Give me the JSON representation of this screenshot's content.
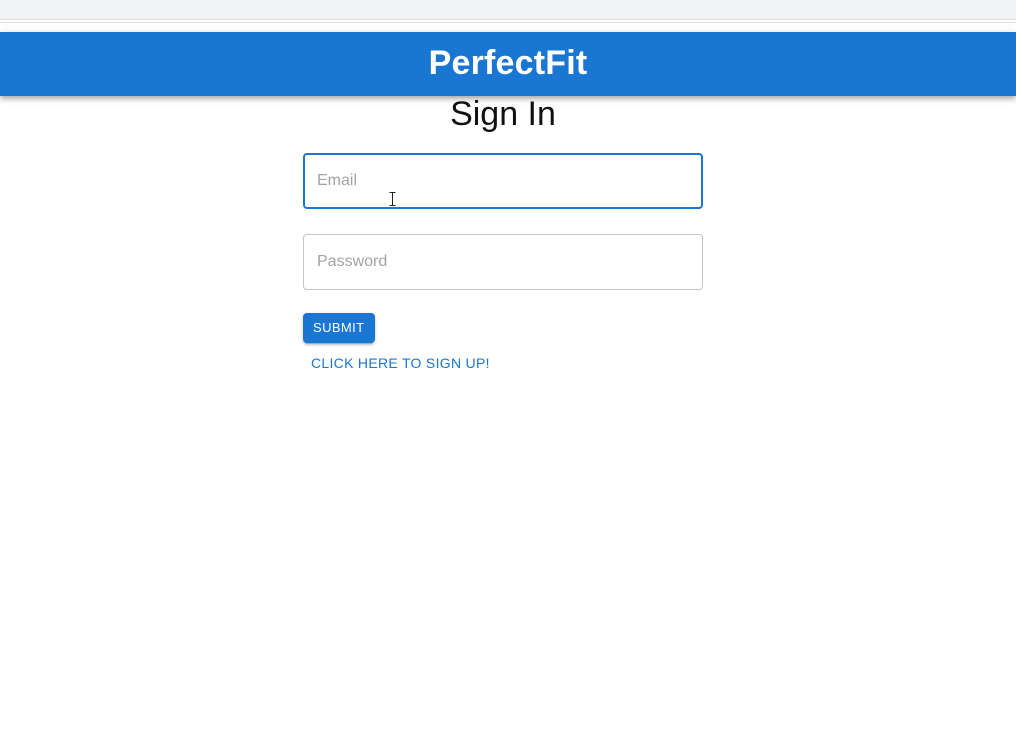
{
  "header": {
    "title": "PerfectFit"
  },
  "page": {
    "title": "Sign In"
  },
  "form": {
    "email": {
      "value": "",
      "placeholder": "Email"
    },
    "password": {
      "value": "",
      "placeholder": "Password"
    },
    "submit_label": "SUBMIT",
    "signup_link_label": "CLICK HERE TO SIGN UP!"
  },
  "colors": {
    "primary": "#1976d2",
    "header_text": "#ffffff",
    "placeholder": "#a2a2a2",
    "border": "#c4c4c4"
  },
  "icons": {
    "cursor": "text-cursor-icon"
  }
}
